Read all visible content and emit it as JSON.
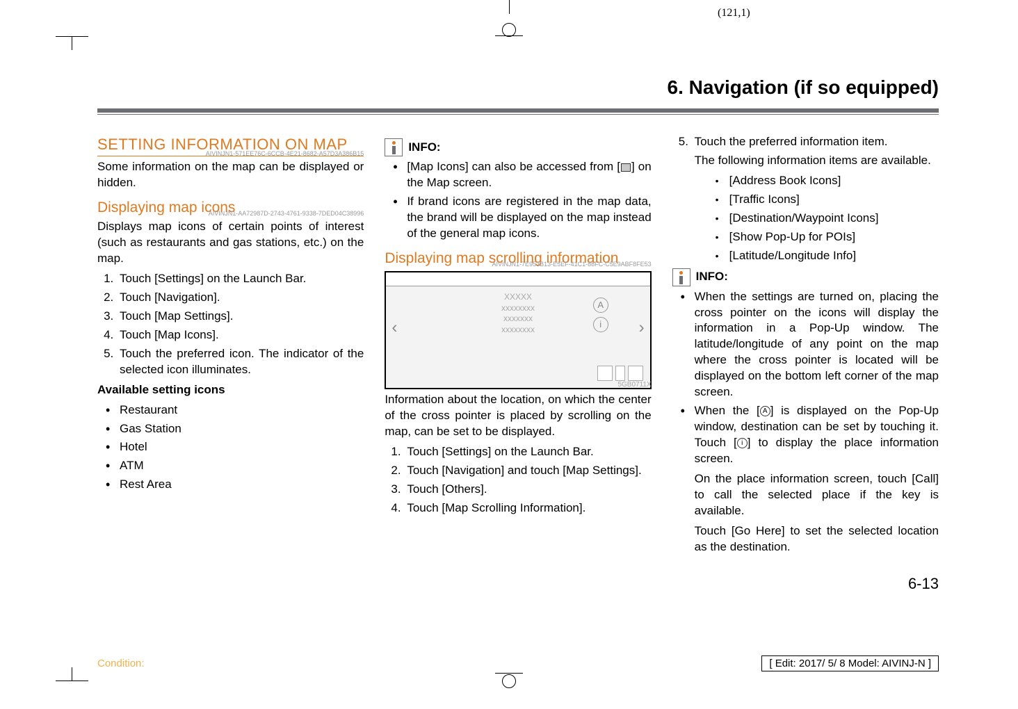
{
  "print_marks": {
    "coord": "(121,1)"
  },
  "chapter_title": "6. Navigation (if so equipped)",
  "col1": {
    "h1": "SETTING INFORMATION ON MAP",
    "guid1": "AIVINJN1-571EE76C-6CCB-4E21-8682-A57D3A386B15",
    "p1": "Some information on the map can be displayed or hidden.",
    "h2": "Displaying map icons",
    "guid2": "AIVINJN1-AA72987D-2743-4761-9338-7DED04C38996",
    "p2": "Displays map icons of certain points of interest (such as restaurants and gas stations, etc.) on the map.",
    "steps": [
      "Touch [Settings] on the Launch Bar.",
      "Touch [Navigation].",
      "Touch [Map Settings].",
      "Touch [Map Icons].",
      "Touch the preferred icon. The indicator of the selected icon illuminates."
    ],
    "avail_header": "Available setting icons",
    "icons": [
      "Restaurant",
      "Gas Station",
      "Hotel",
      "ATM",
      "Rest Area"
    ]
  },
  "col2": {
    "info_label": "INFO:",
    "info_bullets_a": "[Map Icons] can also be accessed from [",
    "info_bullets_a2": "] on the Map screen.",
    "info_bullets_b": "If brand icons are registered in the map data, the brand will be displayed on the map instead of the general map icons.",
    "h2": "Displaying map scrolling information",
    "guid": "AIVINJN1-7E953B13-E5EF-41C1-88FC-C5E9ABF8FE53",
    "fig_xxxxx": "XXXXX",
    "fig_code": "5GB0711X",
    "p1": "Information about the location, on which the center of the cross pointer is placed by scrolling on the map, can be set to be displayed.",
    "steps": [
      "Touch [Settings] on the Launch Bar.",
      "Touch [Navigation] and touch [Map Settings].",
      "Touch [Others].",
      "Touch [Map Scrolling Information]."
    ]
  },
  "col3": {
    "step5_lead": "Touch the preferred information item.",
    "step5_p": "The following information items are available.",
    "step5_items": [
      "[Address Book Icons]",
      "[Traffic Icons]",
      "[Destination/Waypoint Icons]",
      "[Show Pop-Up for POIs]",
      "[Latitude/Longitude Info]"
    ],
    "info_label": "INFO:",
    "bullet1": "When the settings are turned on, placing the cross pointer on the icons will display the information in a Pop-Up window. The latitude/longitude of any point on the map where the cross pointer is located will be displayed on the bottom left corner of the map screen.",
    "bullet2a": "When the [",
    "bullet2b": "] is displayed on the Pop-Up window, destination can be set by touching it. Touch [",
    "bullet2c": "] to display the place information screen.",
    "bullet2p1": "On the place information screen, touch [Call] to call the selected place if the key is available.",
    "bullet2p2": "Touch [Go Here] to set the selected location as the destination."
  },
  "page_number": "6-13",
  "footer": {
    "condition": "Condition:",
    "edit": "[ Edit: 2017/ 5/ 8   Model:  AIVINJ-N ]"
  }
}
